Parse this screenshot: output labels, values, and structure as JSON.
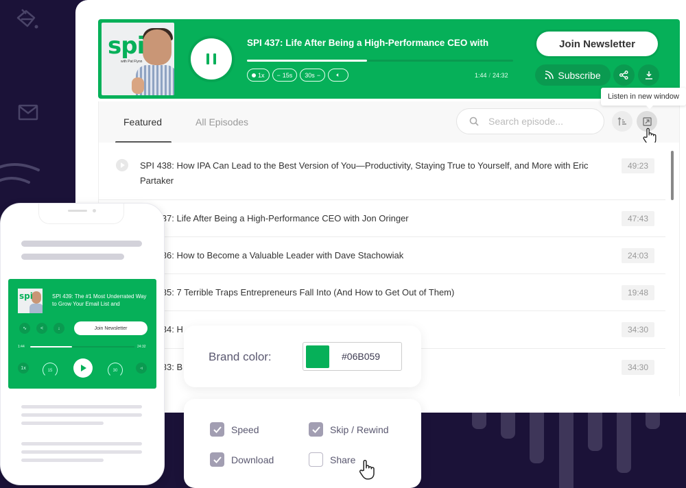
{
  "player": {
    "episode_title": "SPI 437: Life After Being a High-Performance CEO with",
    "progress_fraction": 0.45,
    "elapsed": "1:44",
    "separator": "/",
    "duration": "24:32",
    "controls": [
      "1x",
      "15s",
      "30s"
    ],
    "cover_logo": "spi",
    "cover_sub": "with Pat Flynn",
    "join_newsletter": "Join Newsletter",
    "subscribe": "Subscribe",
    "tooltip": "Listen in new window",
    "brand_color": "#06b059"
  },
  "tabs": [
    {
      "label": "Featured",
      "active": true
    },
    {
      "label": "All Episodes",
      "active": false
    }
  ],
  "search": {
    "placeholder": "Search episode..."
  },
  "episodes": [
    {
      "title": "SPI 438: How IPA Can Lead to the Best Version of You—Productivity, Staying True to Yourself, and More with Eric Partaker",
      "duration": "49:23"
    },
    {
      "title": "SPI 437: Life After Being a High-Performance CEO with Jon Oringer",
      "duration": "47:43"
    },
    {
      "title": "SPI 436: How to Become a Valuable Leader with Dave Stachowiak",
      "duration": "24:03"
    },
    {
      "title": "SPI 435: 7 Terrible Traps Entrepreneurs Fall Into (And How to Get Out of Them)",
      "duration": "19:48"
    },
    {
      "title": "SPI 434: H",
      "duration": "34:30"
    },
    {
      "title": "SPI 433: B",
      "duration": "34:30"
    }
  ],
  "mobile": {
    "episode_title": "SPI 439: The #1 Most Underrated Way to Grow Your Email List and",
    "join_newsletter": "Join Newsletter",
    "elapsed": "1:44",
    "duration": "24:32",
    "progress_fraction": 0.4,
    "speed": "1x",
    "skip_back": "15",
    "skip_forward": "30",
    "cover_logo": "spi"
  },
  "brand": {
    "label": "Brand color:",
    "hex": "#06B059",
    "swatch": "#06b059"
  },
  "options": [
    {
      "label": "Speed",
      "checked": true
    },
    {
      "label": "Skip / Rewind",
      "checked": true
    },
    {
      "label": "Download",
      "checked": true
    },
    {
      "label": "Share",
      "checked": false
    }
  ]
}
